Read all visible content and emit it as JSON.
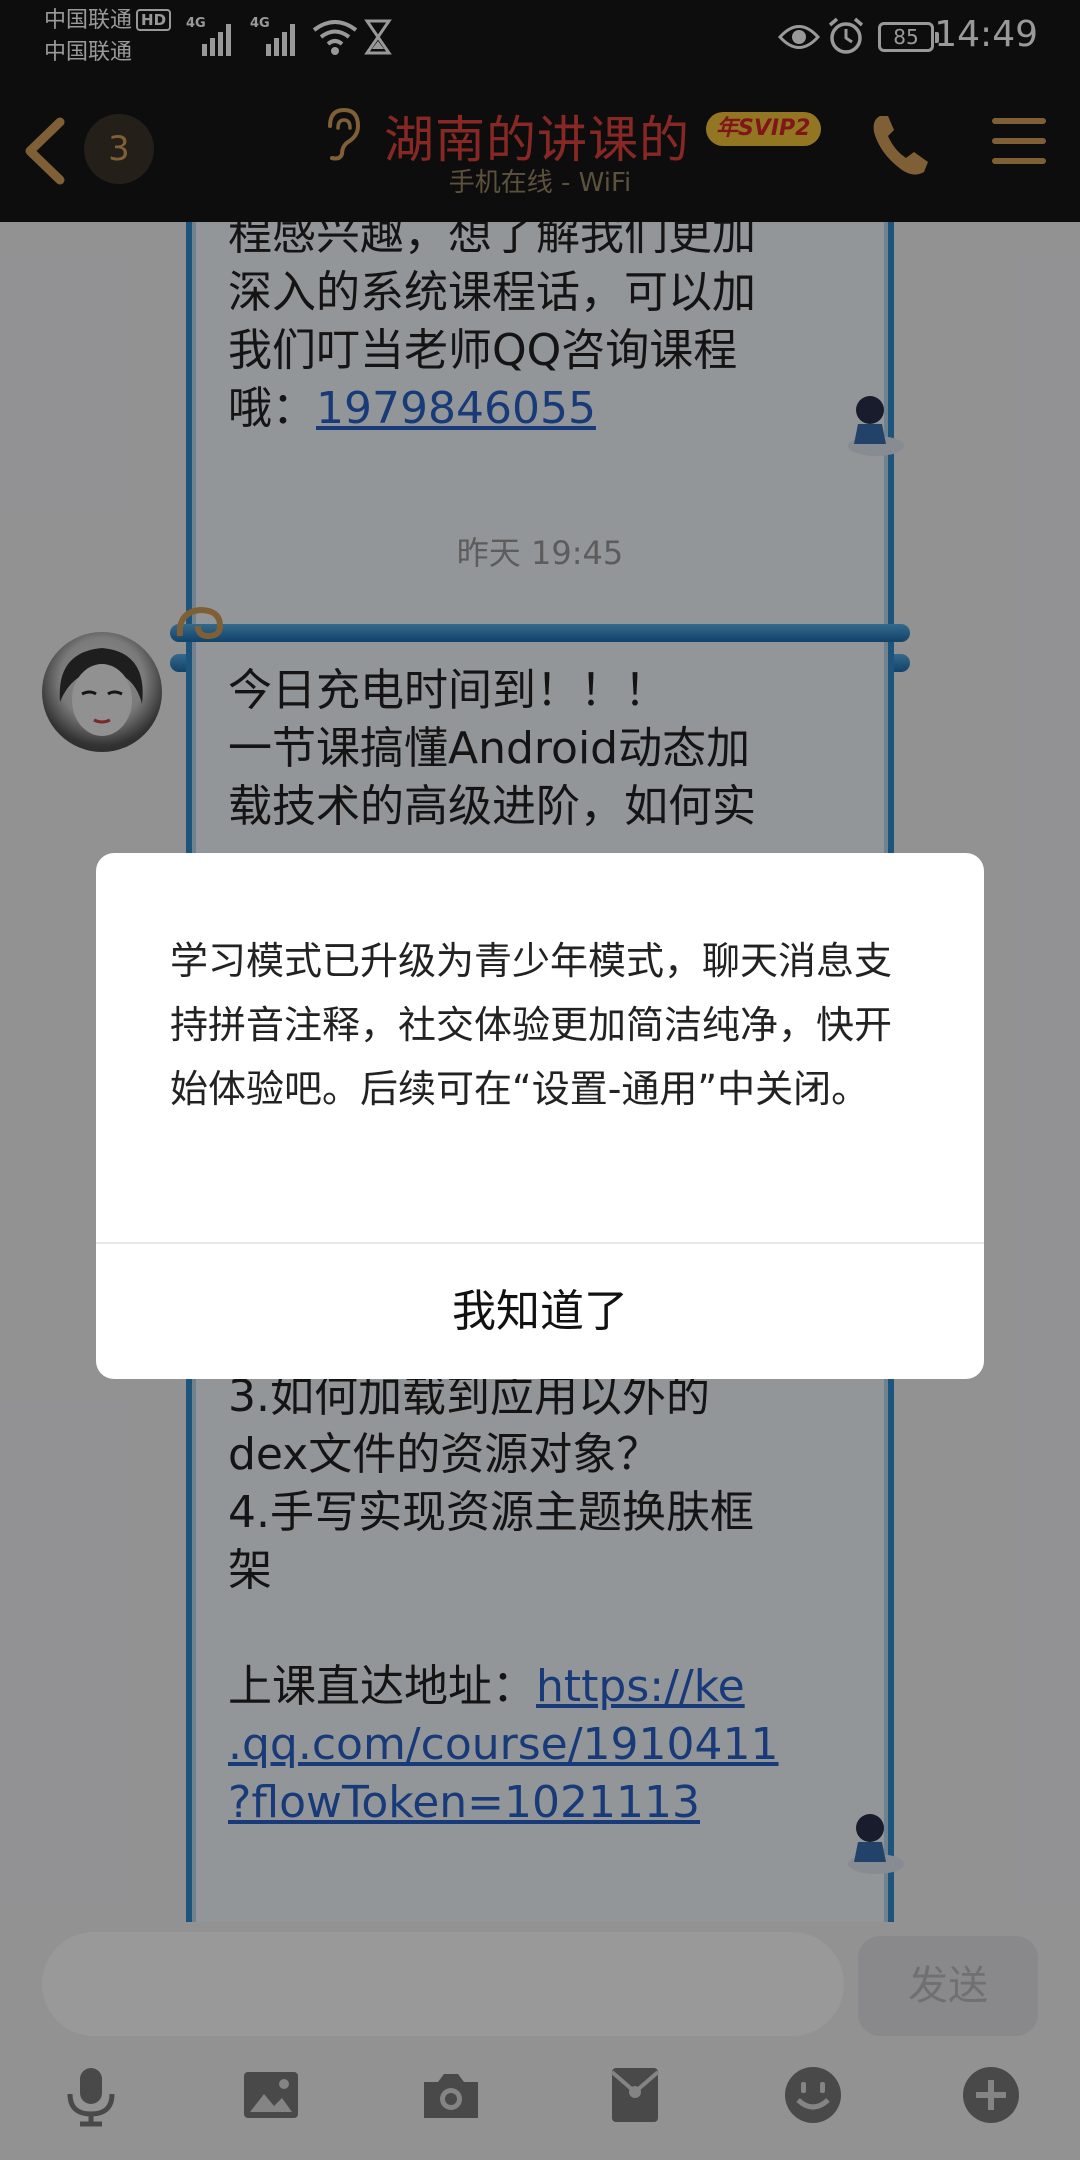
{
  "status_bar": {
    "carrier_1": "中国联通",
    "hd_badge": "HD",
    "carrier_2": "中国联通",
    "network_1": "4G",
    "network_2": "4G",
    "battery": "85",
    "time": "14:49"
  },
  "header": {
    "unread_count": "3",
    "title": "湖南的讲课的",
    "vip_badge": "年SVIP2",
    "subtitle": "手机在线 - WiFi"
  },
  "messages": {
    "prev_text": "程感兴趣，想了解我们更加\n深入的系统课程话，可以加\n我们叮当老师QQ咨询课程\n哦：",
    "prev_link": "1979846055",
    "timestamp": "昨天 19:45",
    "msg_top": "今日充电时间到！！！\n一节课搞懂Android动态加\n载技术的高级进阶，如何实",
    "msg_bottom": "3.如何加载到应用以外的\ndex文件的资源对象？\n4.手写实现资源主题换肤框\n架\n\n上课直达地址：",
    "msg_link": "https://ke\n.qq.com/course/1910411\n?flowToken=1021113"
  },
  "dialog": {
    "text": "学习模式已升级为青少年模式，聊天消息支持拼音注释，社交体验更加简洁纯净，快开始体验吧。后续可在“设置-通用”中关闭。",
    "button": "我知道了"
  },
  "input_bar": {
    "send_label": "发送"
  },
  "colors": {
    "accent_gold": "#d4a15a",
    "title_red": "#e2443c",
    "scroll_blue": "#2f8dce",
    "link_blue": "#2b62c9"
  },
  "icons": [
    "voice-icon",
    "image-icon",
    "camera-icon",
    "red-packet-icon",
    "emoji-icon",
    "plus-icon"
  ]
}
